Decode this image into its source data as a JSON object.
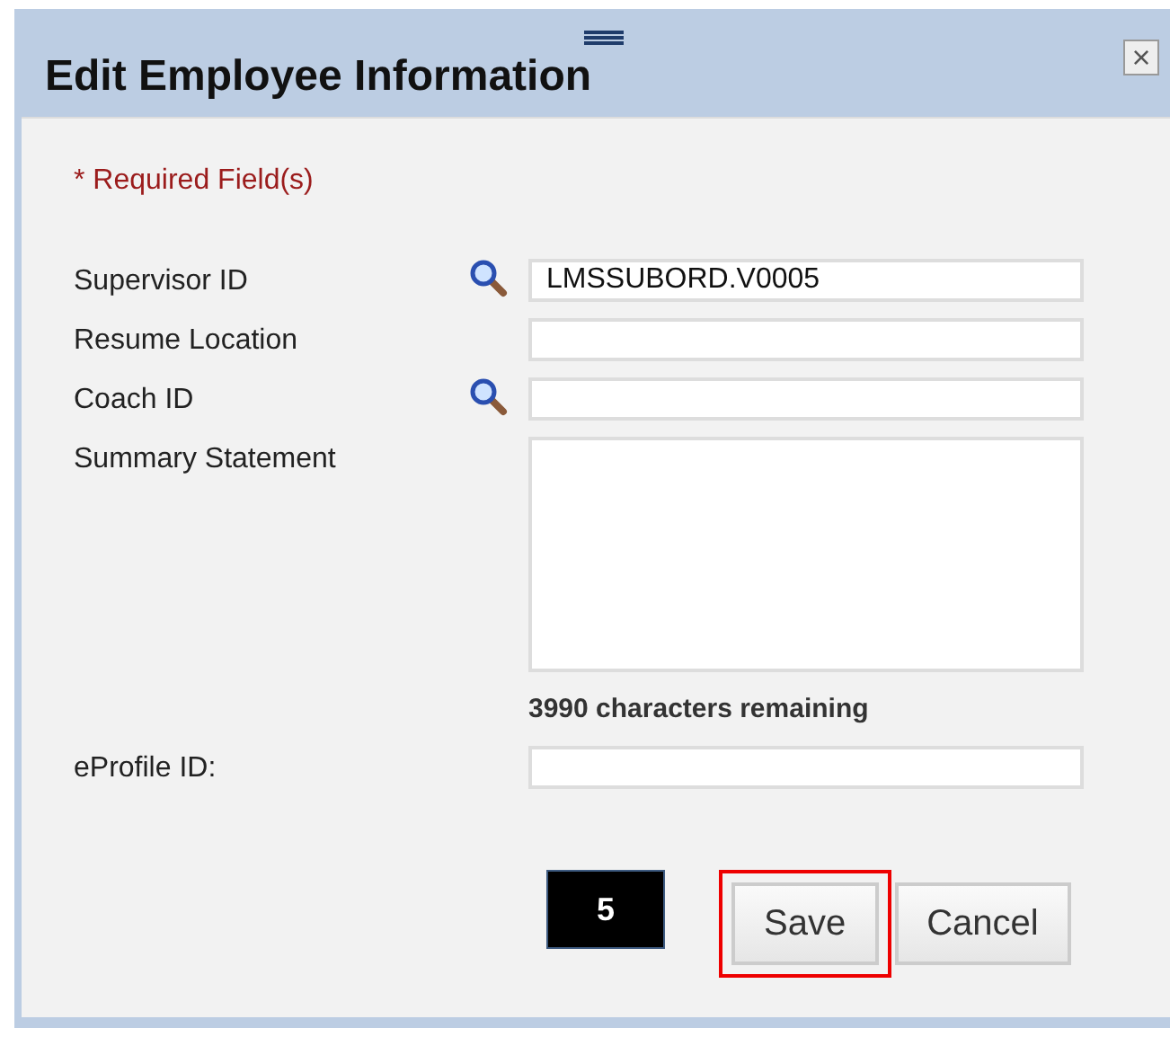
{
  "dialog": {
    "title": "Edit Employee Information",
    "close": "×"
  },
  "required_note": "* Required Field(s)",
  "fields": [
    {
      "label": "Supervisor ID",
      "kind": "lookup",
      "value": "LMSSUBORD.V0005"
    },
    {
      "label": "Resume Location",
      "kind": "text"
    },
    {
      "label": "Coach ID",
      "kind": "lookup"
    },
    {
      "label": "Summary Statement",
      "kind": "textarea",
      "counter": "3990 characters remaining"
    },
    {
      "label": "eProfile ID:",
      "kind": "text"
    }
  ],
  "step_marker": "5",
  "buttons": [
    {
      "label": "Save",
      "highlighted": true
    },
    {
      "label": "Cancel",
      "highlighted": false
    }
  ]
}
